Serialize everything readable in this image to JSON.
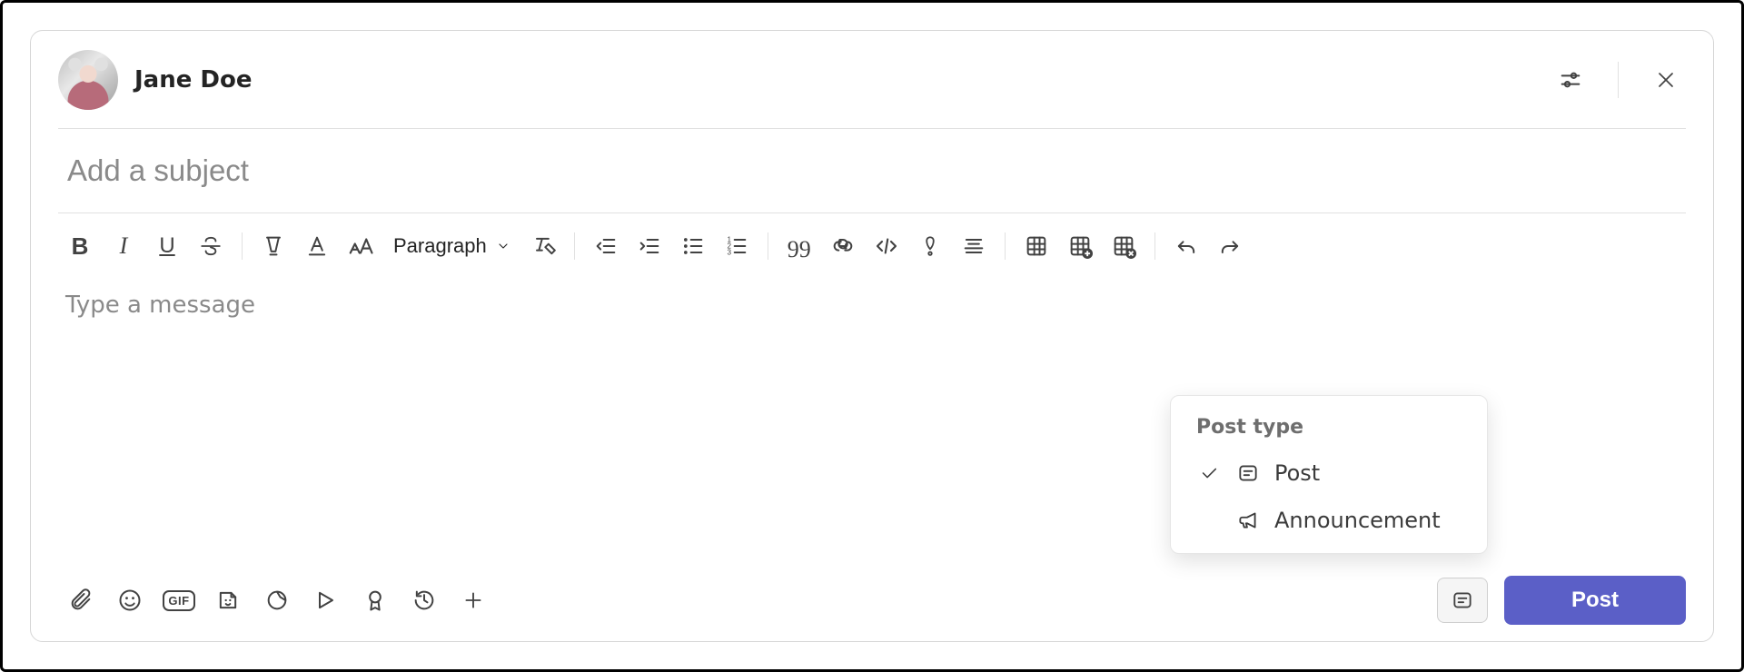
{
  "header": {
    "author_name": "Jane Doe",
    "settings_tooltip": "Options",
    "close_tooltip": "Close"
  },
  "subject": {
    "placeholder": "Add a subject",
    "value": ""
  },
  "toolbar": {
    "bold": "Bold",
    "italic": "Italic",
    "underline": "Underline",
    "strike": "Strikethrough",
    "highlighter": "Text highlight color",
    "font_color": "Font color",
    "font_size": "Font size",
    "paragraph_label": "Paragraph",
    "clear_formatting": "Clear formatting",
    "indent_decrease": "Decrease indent",
    "indent_increase": "Increase indent",
    "bulleted_list": "Bulleted list",
    "numbered_list": "Numbered list",
    "quote": "Quote",
    "link": "Insert link",
    "code": "Code snippet",
    "important": "Mark as important",
    "horizontal_rule": "Insert horizontal rule",
    "table": "Insert table",
    "table_add": "Add table",
    "table_delete": "Delete table",
    "undo": "Undo",
    "redo": "Redo"
  },
  "body": {
    "placeholder": "Type a message",
    "value": ""
  },
  "footer": {
    "attach": "Attach files",
    "emoji": "Emoji",
    "gif_label": "GIF",
    "sticker": "Sticker",
    "loop": "Loop components",
    "stream": "Stream",
    "praise": "Praise",
    "schedule": "Schedule send",
    "more": "More options",
    "post_type_btn": "Post type",
    "post_button": "Post"
  },
  "post_type_menu": {
    "title": "Post type",
    "items": [
      {
        "label": "Post",
        "selected": true,
        "icon": "post"
      },
      {
        "label": "Announcement",
        "selected": false,
        "icon": "announcement"
      }
    ]
  }
}
